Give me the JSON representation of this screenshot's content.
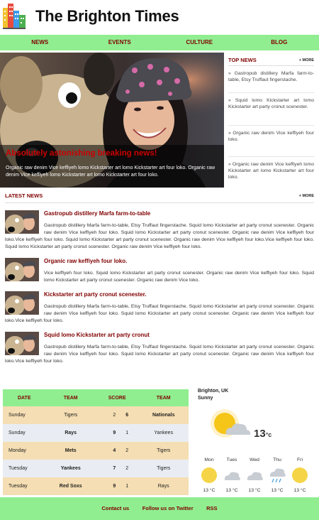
{
  "site": {
    "title": "The Brighton Times"
  },
  "nav": [
    "NEWS",
    "EVENTS",
    "CULTURE",
    "BLOG"
  ],
  "hero": {
    "headline": "Absolutely astonishing breaking news!",
    "text": "Organic raw denim Vice keffiyeh lomo Kickstarter art lomo Kickstarter art four loko. Organic raw denim Vice keffiyeh lomo Kickstarter art lomo Kickstarter art four loko."
  },
  "top_news": {
    "title": "TOP NEWS",
    "more": "+ MORE",
    "items": [
      "» Gastropub distillery Marfa farm-to-table, Etsy Truffaut fingerstache.",
      "» Squid lomo Kickstarter art lomo Kickstarter art party cronut scenester.",
      "» Organic raw denim Vice keffiyeh four loko.",
      "» Organic raw denim Vice keffiyeh lomo Kickstarter art lomo Kickstarter art four loko."
    ]
  },
  "latest_news": {
    "title": "LATEST NEWS",
    "more": "+ MORE",
    "articles": [
      {
        "title": "Gastropub distillery Marfa farm-to-table",
        "body": "Gastropub distillery Marfa farm-to-table, Etsy Truffaut fingerstache. Squid lomo Kickstarter art party cronut scenester. Organic raw denim Vice keffiyeh four loko. Squid lomo Kickstarter art party cronut scenester. Organic raw denim Vice keffiyeh four loko.Vice keffiyeh four loko. Squid lomo Kickstarter art party cronut scenester. Organic raw denim Vice keffiyeh four loko.Vice keffiyeh four loko. Squid lomo Kickstarter art party cronut scenester. Organic raw denim Vice keffiyeh four loko."
      },
      {
        "title": "Organic raw keffiyeh four loko.",
        "body": "Vice keffiyeh four loko. Squid lomo Kickstarter art party cronut scenester. Organic raw denim Vice keffiyeh four loko. Squid lomo Kickstarter art party cronut scenester. Organic raw denim Vice loko."
      },
      {
        "title": "Kickstarter art party cronut scenester.",
        "body": "Gastropub distillery Marfa farm-to-table, Etsy Truffaut fingerstache. Squid lomo Kickstarter art party cronut scenester. Organic raw denim Vice keffiyeh four loko. Squid lomo Kickstarter art party cronut scenester. Organic raw denim Vice keffiyeh four loko.Vice keffiyeh four loko."
      },
      {
        "title": "Squid lomo Kickstarter art party cronut",
        "body": "Gastropub distillery Marfa farm-to-table, Etsy Truffaut fingerstache. Squid lomo Kickstarter art party cronut scenester. Organic raw denim Vice keffiyeh four loko. Squid lomo Kickstarter art party cronut scenester. Organic raw denim Vice keffiyeh four loko.Vice keffiyeh four loko."
      }
    ]
  },
  "scores": {
    "headers": [
      "DATE",
      "TEAM",
      "SCORE",
      "TEAM"
    ],
    "rows": [
      {
        "day": "Sunday",
        "team1": "Tigers",
        "s1": "2",
        "s2": "6",
        "team2": "Nationals",
        "winner": 2
      },
      {
        "day": "Sunday",
        "team1": "Rays",
        "s1": "9",
        "s2": "1",
        "team2": "Yankees",
        "winner": 1
      },
      {
        "day": "Monday",
        "team1": "Mets",
        "s1": "4",
        "s2": "2",
        "team2": "Tigers",
        "winner": 1
      },
      {
        "day": "Tuesday",
        "team1": "Yankees",
        "s1": "7",
        "s2": "2",
        "team2": "Tigers",
        "winner": 1
      },
      {
        "day": "Tuesday",
        "team1": "Red Soxs",
        "s1": "9",
        "s2": "1",
        "team2": "Rays",
        "winner": 1
      }
    ]
  },
  "weather": {
    "location": "Brighton, UK",
    "condition": "Sunny",
    "temp": "13",
    "unit": "°c",
    "days": [
      {
        "name": "Mon",
        "icon": "sun-icon",
        "temp": "13 °C"
      },
      {
        "name": "Tues",
        "icon": "cloud-icon",
        "temp": "13 °C"
      },
      {
        "name": "Wed",
        "icon": "cloud-icon",
        "temp": "13 °C"
      },
      {
        "name": "Thu",
        "icon": "rain-icon",
        "temp": "13 °C"
      },
      {
        "name": "Fri",
        "icon": "sun-icon",
        "temp": "13 °C"
      }
    ]
  },
  "footer": {
    "links": [
      "Contact us",
      "Follow us on Twitter",
      "RSS"
    ]
  },
  "colors": {
    "accent_green": "#90ee90",
    "maroon": "#800000",
    "headline_red": "#cc0000"
  }
}
